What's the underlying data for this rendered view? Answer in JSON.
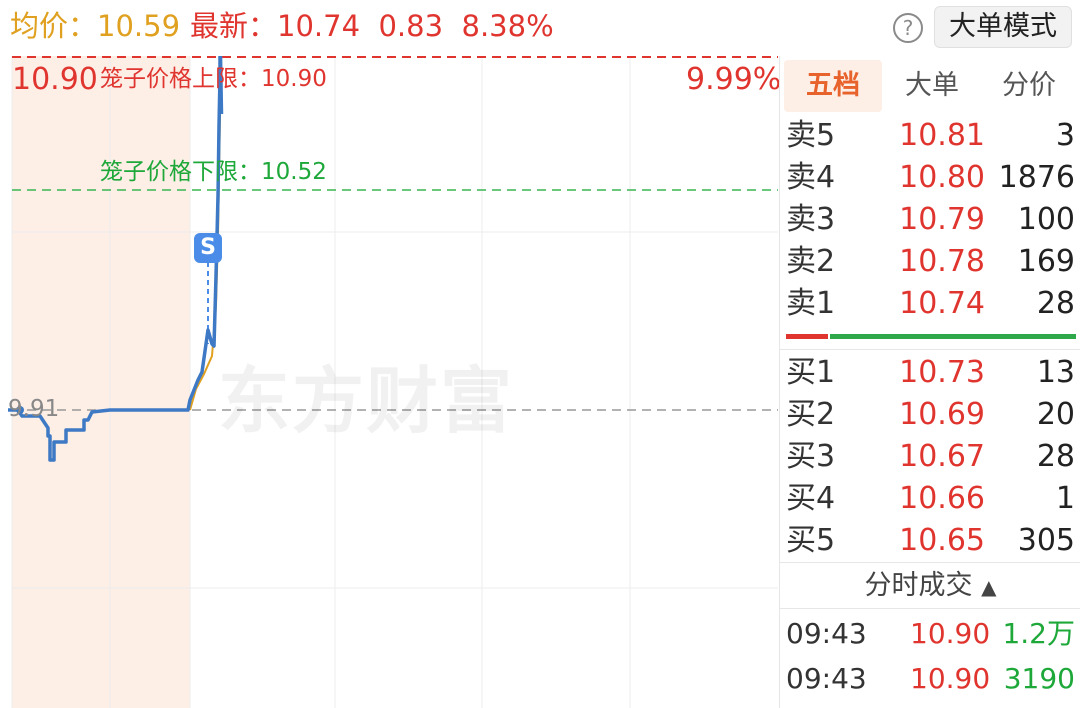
{
  "header": {
    "avg_label": "均价：",
    "avg_value": "10.59",
    "latest_label": "最新：",
    "latest_price": "10.74",
    "change": "0.83",
    "change_pct": "8.38%",
    "help_icon": "question-circle-icon",
    "mode_button": "大单模式"
  },
  "chart": {
    "upper_price": "10.90",
    "upper_cage_label": "笼子价格上限：",
    "upper_cage_value": "10.90",
    "upper_pct": "9.99%",
    "lower_cage_label": "笼子价格下限：",
    "lower_cage_value": "10.52",
    "prev_close": "9.91",
    "watermark": "东方财富",
    "marker_label": "S",
    "colors": {
      "price_line": "#3d79c4",
      "avg_line": "#e0a020",
      "up": "#e0352f",
      "down": "#1ea83a",
      "shade": "#fdeee6"
    }
  },
  "panel": {
    "tabs": [
      {
        "label": "五档",
        "active": true
      },
      {
        "label": "大单",
        "active": false
      },
      {
        "label": "分价",
        "active": false
      }
    ],
    "asks": [
      {
        "label": "卖5",
        "price": "10.81",
        "volume": "3"
      },
      {
        "label": "卖4",
        "price": "10.80",
        "volume": "1876"
      },
      {
        "label": "卖3",
        "price": "10.79",
        "volume": "100"
      },
      {
        "label": "卖2",
        "price": "10.78",
        "volume": "169"
      },
      {
        "label": "卖1",
        "price": "10.74",
        "volume": "28"
      }
    ],
    "bids": [
      {
        "label": "买1",
        "price": "10.73",
        "volume": "13"
      },
      {
        "label": "买2",
        "price": "10.69",
        "volume": "20"
      },
      {
        "label": "买3",
        "price": "10.67",
        "volume": "28"
      },
      {
        "label": "买4",
        "price": "10.66",
        "volume": "1"
      },
      {
        "label": "买5",
        "price": "10.65",
        "volume": "305"
      }
    ],
    "ticks_title": "分时成交",
    "ticks_icon": "triangle-up-icon",
    "ticks": [
      {
        "time": "09:43",
        "price": "10.90",
        "volume": "1.2万"
      },
      {
        "time": "09:43",
        "price": "10.90",
        "volume": "3190"
      }
    ]
  }
}
